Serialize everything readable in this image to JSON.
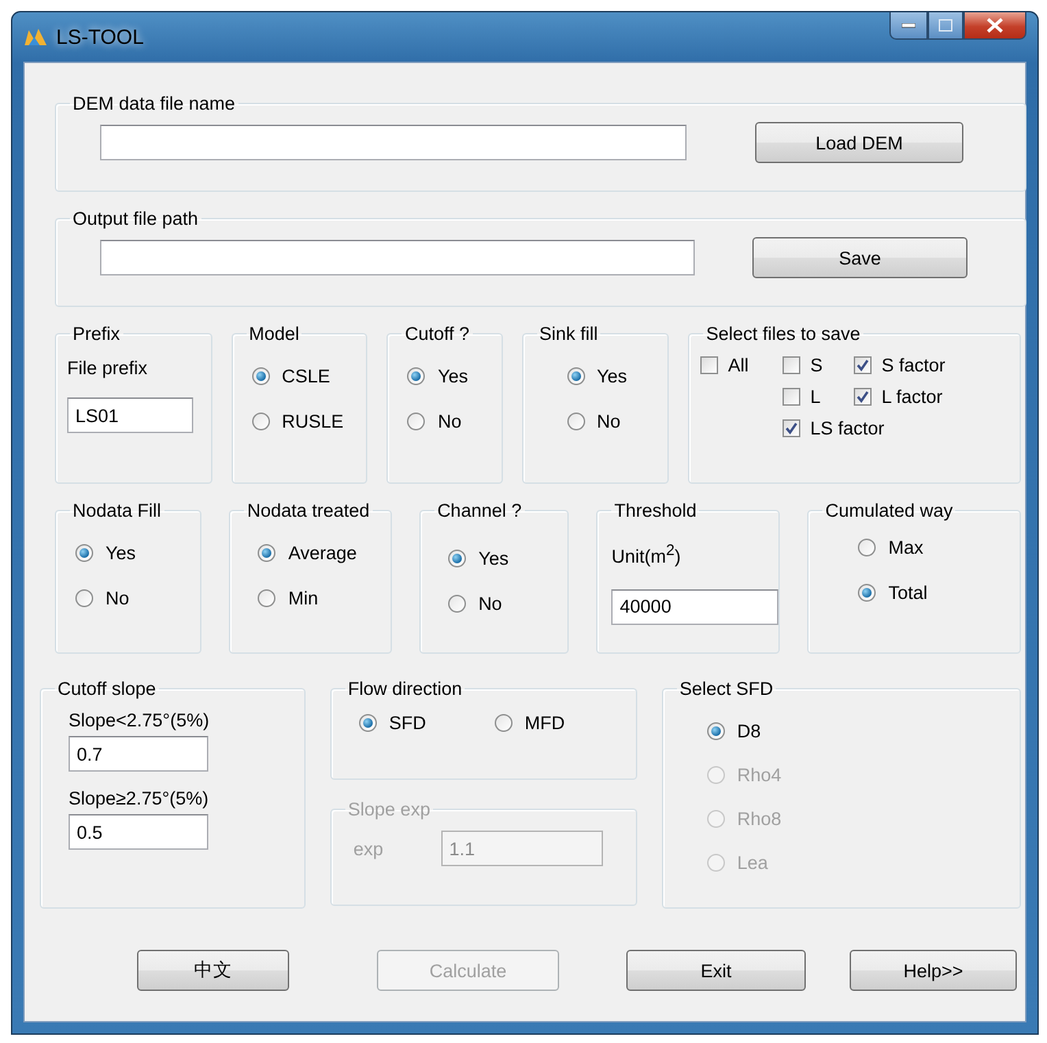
{
  "window": {
    "title": "LS-TOOL"
  },
  "dem": {
    "legend": "DEM data file name",
    "button": "Load DEM"
  },
  "output": {
    "legend": "Output file path",
    "button": "Save"
  },
  "prefix": {
    "legend": "Prefix",
    "label": "File prefix",
    "value": "LS01"
  },
  "model": {
    "legend": "Model",
    "options": [
      {
        "label": "CSLE",
        "selected": true
      },
      {
        "label": "RUSLE",
        "selected": false
      }
    ]
  },
  "cutoff": {
    "legend": "Cutoff ?",
    "options": [
      {
        "label": "Yes",
        "selected": true
      },
      {
        "label": "No",
        "selected": false
      }
    ]
  },
  "sink_fill": {
    "legend": "Sink fill",
    "options": [
      {
        "label": "Yes",
        "selected": true
      },
      {
        "label": "No",
        "selected": false
      }
    ]
  },
  "select_files": {
    "legend": "Select files to save",
    "items": [
      {
        "label": "All",
        "checked": false
      },
      {
        "label": "S",
        "checked": false
      },
      {
        "label": "S factor",
        "checked": true
      },
      {
        "label": "L",
        "checked": false
      },
      {
        "label": "L factor",
        "checked": true
      },
      {
        "label": "LS factor",
        "checked": true
      }
    ]
  },
  "nodata_fill": {
    "legend": "Nodata Fill",
    "options": [
      {
        "label": "Yes",
        "selected": true
      },
      {
        "label": "No",
        "selected": false
      }
    ]
  },
  "nodata_treated": {
    "legend": "Nodata treated",
    "options": [
      {
        "label": "Average",
        "selected": true
      },
      {
        "label": "Min",
        "selected": false
      }
    ]
  },
  "channel": {
    "legend": "Channel ?",
    "options": [
      {
        "label": "Yes",
        "selected": true
      },
      {
        "label": "No",
        "selected": false
      }
    ]
  },
  "threshold": {
    "legend": "Threshold",
    "label": "Unit(m$^{2}$)",
    "value": "40000"
  },
  "cumulated_way": {
    "legend": "Cumulated way",
    "options": [
      {
        "label": "Max",
        "selected": false
      },
      {
        "label": "Total",
        "selected": true
      }
    ]
  },
  "cutoff_slope": {
    "legend": "Cutoff slope",
    "fields": [
      {
        "label": "Slope<2.75°(5%)",
        "value": "0.7"
      },
      {
        "label": "Slope≥2.75°(5%)",
        "value": "0.5"
      }
    ]
  },
  "flow_direction": {
    "legend": "Flow direction",
    "options": [
      {
        "label": "SFD",
        "selected": true
      },
      {
        "label": "MFD",
        "selected": false
      }
    ]
  },
  "slope_exp": {
    "legend": "Slope exp",
    "label": "exp",
    "value": "1.1",
    "disabled": true
  },
  "select_sfd": {
    "legend": "Select SFD",
    "options": [
      {
        "label": "D8",
        "selected": true,
        "disabled": false
      },
      {
        "label": "Rho4",
        "selected": false,
        "disabled": true
      },
      {
        "label": "Rho8",
        "selected": false,
        "disabled": true
      },
      {
        "label": "Lea",
        "selected": false,
        "disabled": true
      }
    ]
  },
  "buttons": [
    {
      "label": "中文",
      "disabled": false
    },
    {
      "label": "Calculate",
      "disabled": true
    },
    {
      "label": "Exit",
      "disabled": false
    },
    {
      "label": "Help>>",
      "disabled": false
    }
  ]
}
